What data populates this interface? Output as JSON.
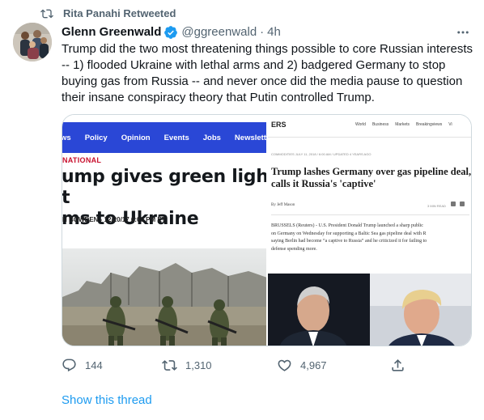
{
  "retweet_banner": {
    "text": "Rita Panahi Retweeted"
  },
  "author": {
    "name": "Glenn Greenwald",
    "handle": "@ggreenwald",
    "separator": "·",
    "time": "4h",
    "verified": true
  },
  "tweet": {
    "text": "Trump did the two most threatening things possible to core Russian interests -- 1) flooded Ukraine with lethal arms and 2) badgered Germany to stop buying gas from Russia -- and never once did the media pause to question their insane conspiracy theory that Putin controlled Trump."
  },
  "media": {
    "left": {
      "nav": [
        "ws",
        "Policy",
        "Opinion",
        "Events",
        "Jobs",
        "Newsletters"
      ],
      "section": "NATIONAL",
      "headline_line1": "ump gives green light t",
      "headline_line2": "ms to Ukraine",
      "byline": "N BOWDEN - 12/20/17 6:00 PM ET"
    },
    "right": {
      "logo": "ERS",
      "nav": [
        "World",
        "Business",
        "Markets",
        "Breakingviews",
        "Vi"
      ],
      "meta": "COMMODITIES   JULY 11, 2018 / 6:00 AM / UPDATED 4 YEARS AGO",
      "headline_line1": "Trump lashes Germany over gas pipeline deal,",
      "headline_line2": "calls it Russia's 'captive'",
      "byline": "By Jeff Mason",
      "read_time": "3 MIN READ",
      "body_line1": "BRUSSELS (Reuters) - U.S. President Donald Trump launched a sharp public",
      "body_line2": "on Germany on Wednesday for supporting a Baltic Sea gas pipeline deal with R",
      "body_line3": "saying Berlin had become “a captive to Russia” and he criticized it for failing to",
      "body_line4": "defense spending more."
    }
  },
  "actions": {
    "replies": "144",
    "retweets": "1,310",
    "likes": "4,967"
  },
  "show_thread": "Show this thread",
  "colors": {
    "accent": "#1d9bf0",
    "secondary_text": "#536471",
    "primary_text": "#0f1419",
    "newsweek_blue": "#2a47d6"
  }
}
